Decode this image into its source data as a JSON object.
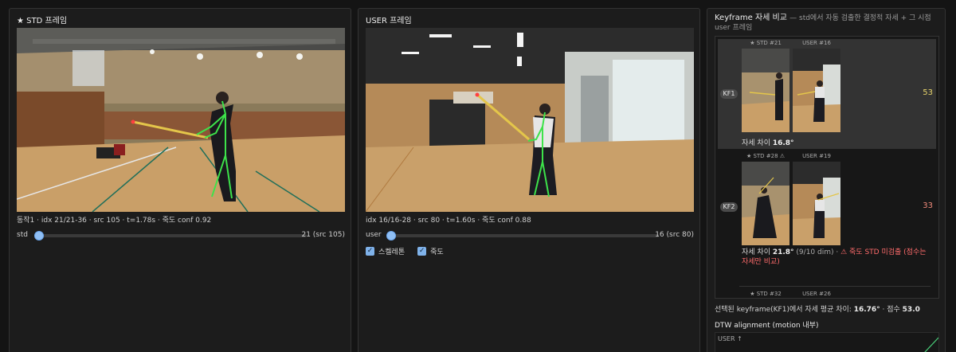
{
  "std_panel": {
    "title": "★ STD 프레임",
    "info": "동작1 · idx 21/21-36 · src 105 · t=1.78s · 죽도 conf 0.92",
    "slider": {
      "label": "std",
      "value_text": "21 (src 105)",
      "fraction": 0.0
    }
  },
  "user_panel": {
    "title": "USER 프레임",
    "info": "idx 16/16-28 · src 80 · t=1.60s · 죽도 conf 0.88",
    "slider": {
      "label": "user",
      "value_text": "16 (src 80)",
      "fraction": 0.0
    },
    "checkboxes": [
      {
        "label": "스켈레톤",
        "checked": true
      },
      {
        "label": "죽도",
        "checked": true
      }
    ]
  },
  "keyframe_panel": {
    "title": "Keyframe 자세 비교",
    "subtitle": "— std에서 자동 검출한 결정적 자세 + 그 시점 user 프레임",
    "items": [
      {
        "badge": "KF1",
        "std_caption": "★ STD #21",
        "user_caption": "USER #16",
        "score": "53",
        "score_color": "#e6d36b",
        "diff_prefix": "자세 차이 ",
        "diff_value": "16.8°",
        "diff_extra": "",
        "warning": ""
      },
      {
        "badge": "KF2",
        "std_caption": "★ STD #28 ⚠",
        "user_caption": "USER #19",
        "score": "33",
        "score_color": "#f08a7a",
        "diff_prefix": "자세 차이 ",
        "diff_value": "21.8°",
        "diff_extra": " (9/10 dim) · ",
        "warning": "⚠ 죽도 STD 미검출 (점수는 자세만 비교)"
      },
      {
        "badge": "",
        "std_caption": "★ STD #32",
        "user_caption": "USER #26"
      }
    ],
    "summary_prefix": "선택된 keyframe(KF1)에서 자세 평균 차이: ",
    "summary_diff": "16.76°",
    "summary_mid": " · 점수 ",
    "summary_score": "53.0",
    "dtw_title": "DTW alignment (motion 내부)",
    "dtw_axis_label": "USER ↑"
  }
}
